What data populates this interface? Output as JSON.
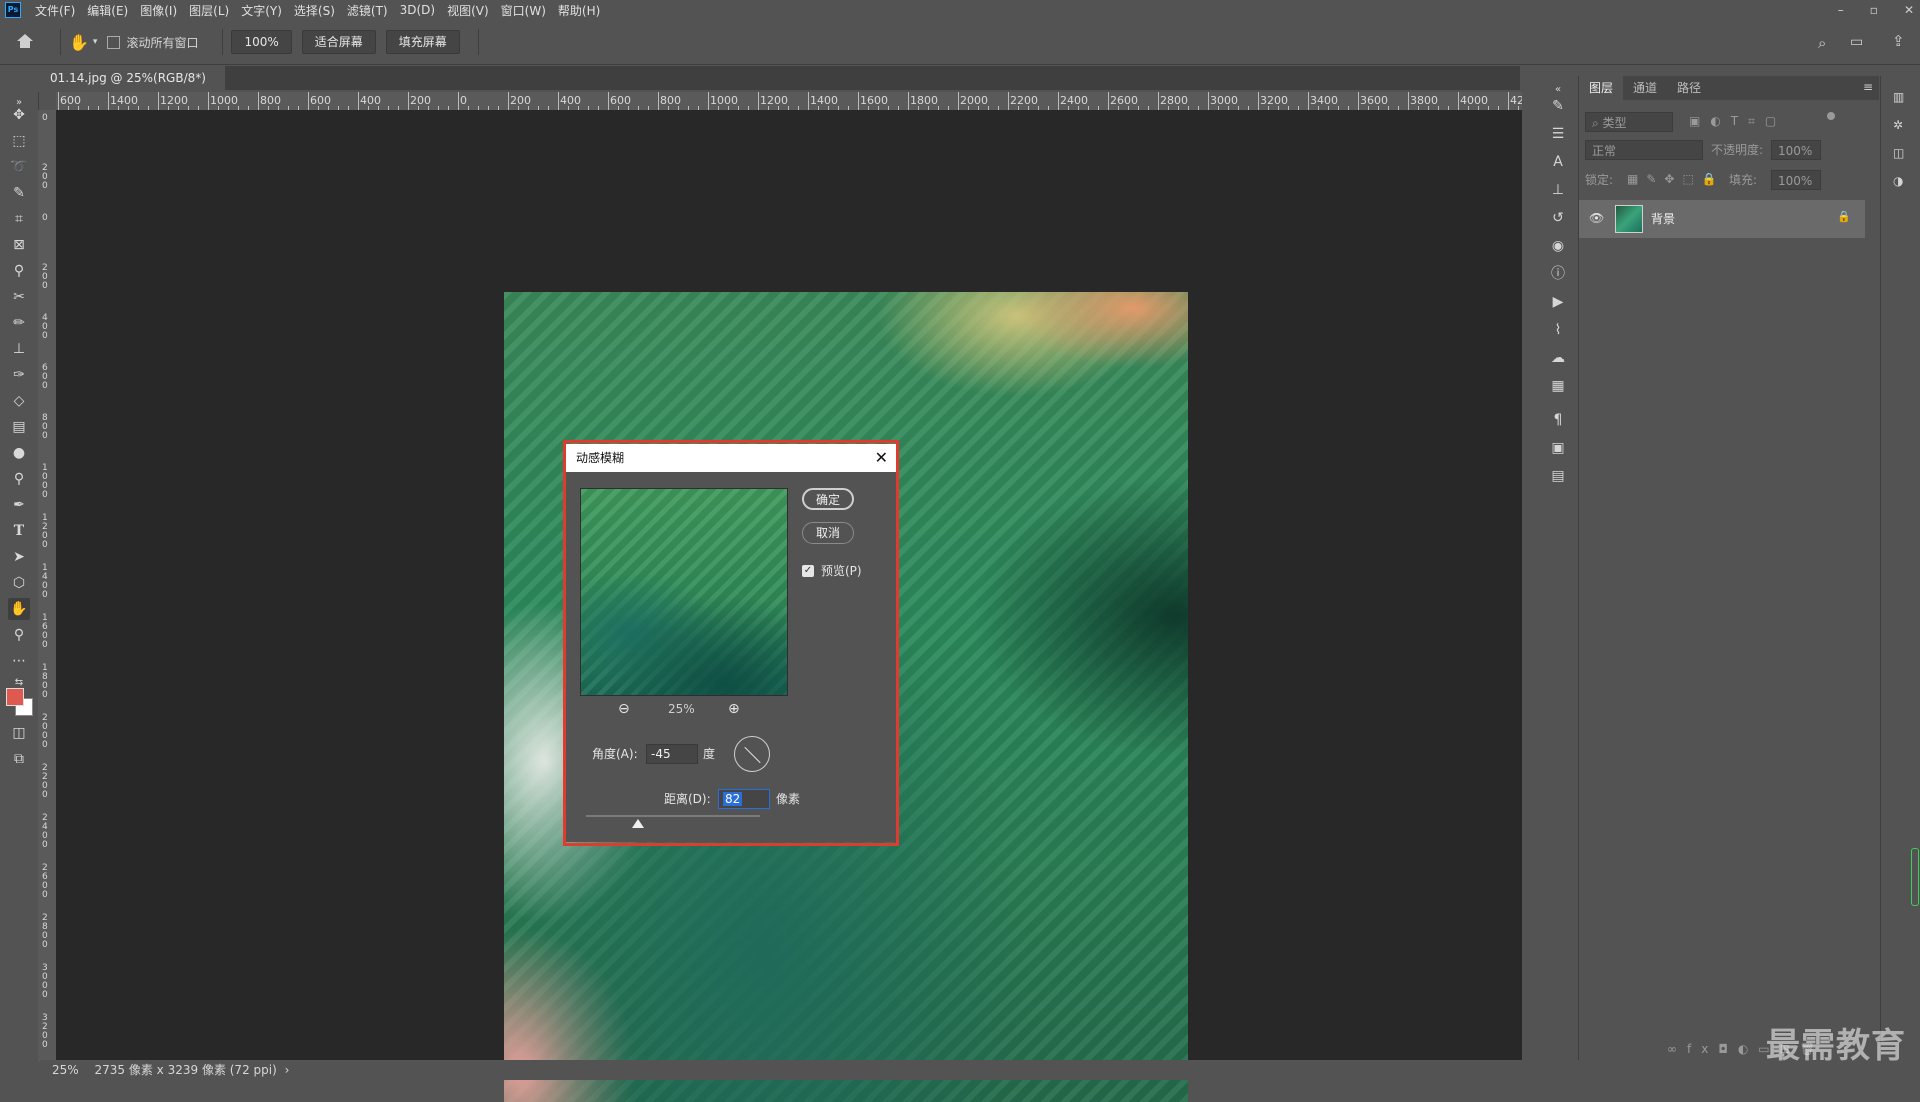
{
  "menubar": {
    "logo": "Ps",
    "items": [
      "文件(F)",
      "编辑(E)",
      "图像(I)",
      "图层(L)",
      "文字(Y)",
      "选择(S)",
      "滤镜(T)",
      "3D(D)",
      "视图(V)",
      "窗口(W)",
      "帮助(H)"
    ],
    "window_controls": [
      "–",
      "▫",
      "✕"
    ]
  },
  "options": {
    "scroll_all_label": "滚动所有窗口",
    "zoom_value": "100%",
    "fit_screen": "适合屏幕",
    "fill_screen": "填充屏幕"
  },
  "document": {
    "tab_title": "01.14.jpg @ 25%(RGB/8*)",
    "tab_close": "×"
  },
  "ruler": {
    "top_labels": [
      "600",
      "1400",
      "1200",
      "1000",
      "800",
      "600",
      "400",
      "200",
      "0",
      "200",
      "400",
      "600",
      "800",
      "1000",
      "1200",
      "1400",
      "1600",
      "1800",
      "2000",
      "2200",
      "2400",
      "2600",
      "2800",
      "3000",
      "3200",
      "3400",
      "3600",
      "3800",
      "4000",
      "420"
    ],
    "left_labels": [
      "0",
      "200",
      "0",
      "200",
      "400",
      "600",
      "800",
      "1000",
      "1200",
      "1400",
      "1600",
      "1800",
      "2000",
      "2200",
      "2400",
      "2600",
      "2800",
      "3000",
      "3200",
      "3400"
    ]
  },
  "dialog": {
    "title": "动感模糊",
    "close": "✕",
    "ok": "确定",
    "cancel": "取消",
    "preview_label": "预览(P)",
    "zoom_percent": "25%",
    "zoom_out": "⊖",
    "zoom_in": "⊕",
    "angle_label": "角度(A):",
    "angle_value": "-45",
    "angle_unit": "度",
    "distance_label": "距离(D):",
    "distance_value": "82",
    "distance_unit": "像素"
  },
  "layers_panel": {
    "tabs": [
      "图层",
      "通道",
      "路径"
    ],
    "filter_placeholder": "类型",
    "blend_mode": "正常",
    "opacity_label": "不透明度:",
    "opacity_value": "100%",
    "lock_label": "锁定:",
    "fill_label": "填充:",
    "fill_value": "100%",
    "layer_name": "背景"
  },
  "status": {
    "zoom": "25%",
    "info": "2735 像素 x 3239 像素 (72 ppi)"
  },
  "watermark": "最需教育",
  "colors": {
    "foreground": "#e0594f",
    "background": "#ffffff",
    "dialog_highlight": "#e23a2e"
  }
}
